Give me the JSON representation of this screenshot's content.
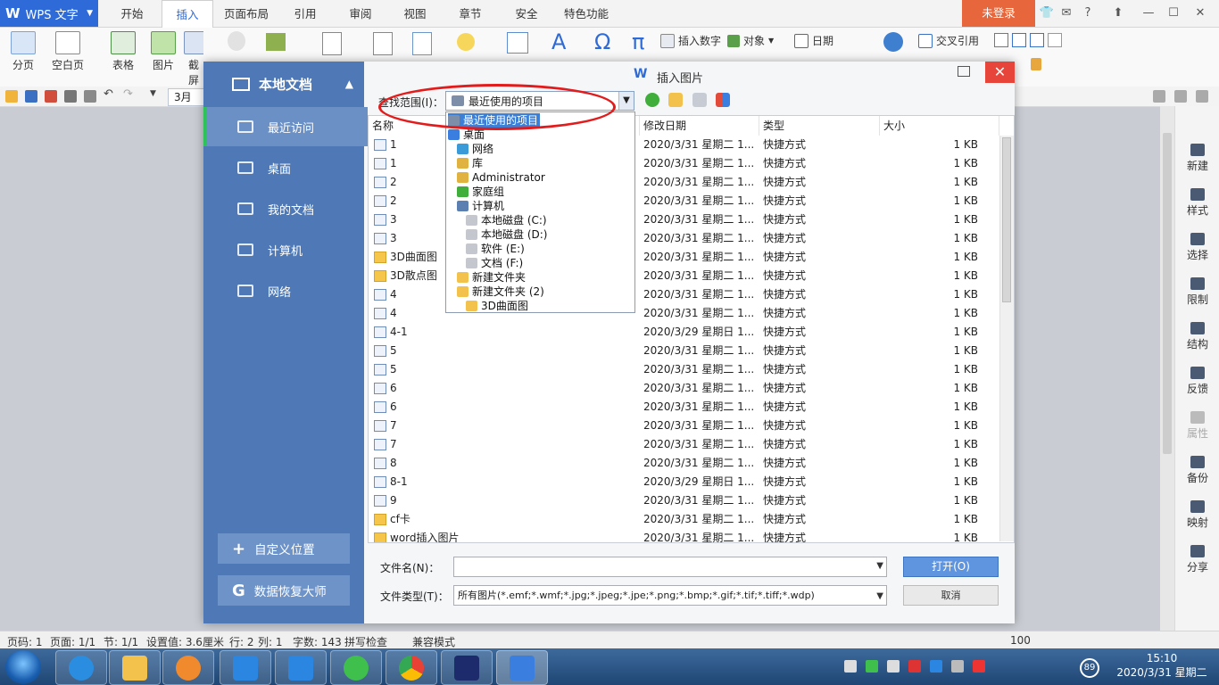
{
  "app": {
    "logo": "W",
    "name": "WPS 文字"
  },
  "tabs": [
    "开始",
    "插入",
    "页面布局",
    "引用",
    "审阅",
    "视图",
    "章节",
    "安全",
    "特色功能"
  ],
  "active_tab": "插入",
  "login_label": "未登录",
  "ribbon": {
    "big": [
      "分页",
      "空白页",
      "表格",
      "图片",
      "截屏"
    ],
    "small": [
      "插入数字",
      "对象",
      "日期",
      "交叉引用"
    ]
  },
  "doc_tab_label": "3月",
  "dialog": {
    "title": "插入图片",
    "left_header": "本地文档",
    "left_items": [
      "最近访问",
      "桌面",
      "我的文档",
      "计算机",
      "网络"
    ],
    "custom_location": "自定义位置",
    "recovery": "数据恢复大师",
    "lookin_label": "查找范围(I)：",
    "lookin_value": "最近使用的项目",
    "columns": {
      "name": "名称",
      "date": "修改日期",
      "type": "类型",
      "size": "大小"
    },
    "files": [
      {
        "name": "1",
        "date": "2020/3/31 星期二 1...",
        "type": "快捷方式",
        "size": "1 KB"
      },
      {
        "name": "1",
        "date": "2020/3/31 星期二 1...",
        "type": "快捷方式",
        "size": "1 KB"
      },
      {
        "name": "2",
        "date": "2020/3/31 星期二 1...",
        "type": "快捷方式",
        "size": "1 KB"
      },
      {
        "name": "2",
        "date": "2020/3/31 星期二 1...",
        "type": "快捷方式",
        "size": "1 KB"
      },
      {
        "name": "3",
        "date": "2020/3/31 星期二 1...",
        "type": "快捷方式",
        "size": "1 KB"
      },
      {
        "name": "3",
        "date": "2020/3/31 星期二 1...",
        "type": "快捷方式",
        "size": "1 KB"
      },
      {
        "name": "3D曲面图",
        "date": "2020/3/31 星期二 1...",
        "type": "快捷方式",
        "size": "1 KB"
      },
      {
        "name": "3D散点图",
        "date": "2020/3/31 星期二 1...",
        "type": "快捷方式",
        "size": "1 KB"
      },
      {
        "name": "4",
        "date": "2020/3/31 星期二 1...",
        "type": "快捷方式",
        "size": "1 KB"
      },
      {
        "name": "4",
        "date": "2020/3/31 星期二 1...",
        "type": "快捷方式",
        "size": "1 KB"
      },
      {
        "name": "4-1",
        "date": "2020/3/29 星期日 1...",
        "type": "快捷方式",
        "size": "1 KB"
      },
      {
        "name": "5",
        "date": "2020/3/31 星期二 1...",
        "type": "快捷方式",
        "size": "1 KB"
      },
      {
        "name": "5",
        "date": "2020/3/31 星期二 1...",
        "type": "快捷方式",
        "size": "1 KB"
      },
      {
        "name": "6",
        "date": "2020/3/31 星期二 1...",
        "type": "快捷方式",
        "size": "1 KB"
      },
      {
        "name": "6",
        "date": "2020/3/31 星期二 1...",
        "type": "快捷方式",
        "size": "1 KB"
      },
      {
        "name": "7",
        "date": "2020/3/31 星期二 1...",
        "type": "快捷方式",
        "size": "1 KB"
      },
      {
        "name": "7",
        "date": "2020/3/31 星期二 1...",
        "type": "快捷方式",
        "size": "1 KB"
      },
      {
        "name": "8",
        "date": "2020/3/31 星期二 1...",
        "type": "快捷方式",
        "size": "1 KB"
      },
      {
        "name": "8-1",
        "date": "2020/3/29 星期日 1...",
        "type": "快捷方式",
        "size": "1 KB"
      },
      {
        "name": "9",
        "date": "2020/3/31 星期二 1...",
        "type": "快捷方式",
        "size": "1 KB"
      },
      {
        "name": "cf卡",
        "date": "2020/3/31 星期二 1...",
        "type": "快捷方式",
        "size": "1 KB"
      },
      {
        "name": "word插入图片",
        "date": "2020/3/31 星期二 1...",
        "type": "快捷方式",
        "size": "1 KB"
      }
    ],
    "dropdown_items": [
      {
        "label": "最近使用的项目",
        "indent": 0,
        "selected": true,
        "icon": "recent-icon"
      },
      {
        "label": "桌面",
        "indent": 0,
        "selected": false,
        "icon": "desktop-icon"
      },
      {
        "label": "网络",
        "indent": 1,
        "selected": false,
        "icon": "network-icon"
      },
      {
        "label": "库",
        "indent": 1,
        "selected": false,
        "icon": "library-icon"
      },
      {
        "label": "Administrator",
        "indent": 1,
        "selected": false,
        "icon": "user-folder-icon"
      },
      {
        "label": "家庭组",
        "indent": 1,
        "selected": false,
        "icon": "homegroup-icon"
      },
      {
        "label": "计算机",
        "indent": 1,
        "selected": false,
        "icon": "computer-icon"
      },
      {
        "label": "本地磁盘 (C:)",
        "indent": 2,
        "selected": false,
        "icon": "drive-icon"
      },
      {
        "label": "本地磁盘 (D:)",
        "indent": 2,
        "selected": false,
        "icon": "drive-icon"
      },
      {
        "label": "软件 (E:)",
        "indent": 2,
        "selected": false,
        "icon": "drive-icon"
      },
      {
        "label": "文档 (F:)",
        "indent": 2,
        "selected": false,
        "icon": "drive-icon"
      },
      {
        "label": "新建文件夹",
        "indent": 1,
        "selected": false,
        "icon": "folder-icon"
      },
      {
        "label": "新建文件夹 (2)",
        "indent": 1,
        "selected": false,
        "icon": "folder-icon"
      },
      {
        "label": "3D曲面图",
        "indent": 2,
        "selected": false,
        "icon": "folder-icon"
      }
    ],
    "filename_label": "文件名(N)：",
    "filename_value": "",
    "filetype_label": "文件类型(T)：",
    "filetype_value": "所有图片(*.emf;*.wmf;*.jpg;*.jpeg;*.jpe;*.png;*.bmp;*.gif;*.tif;*.tiff;*.wdp)",
    "open_label": "打开(O)",
    "cancel_label": "取消"
  },
  "right_panel": [
    "新建",
    "样式",
    "选择",
    "限制",
    "结构",
    "反馈",
    "属性",
    "备份",
    "映射",
    "分享"
  ],
  "status": {
    "page_code": "页码: 1",
    "pages": "页面: 1/1",
    "section": "节: 1/1",
    "setting": "设置值: 3.6厘米",
    "line": "行: 2",
    "col": "列: 1",
    "words": "字数: 143",
    "spell": "拼写检查",
    "compat": "兼容模式",
    "zoom": "100"
  },
  "clock": {
    "time": "15:10",
    "date": "2020/3/31 星期二"
  },
  "tray_badge": "89",
  "colors": {
    "accent": "#2f6bd8",
    "login": "#e8663c",
    "dialog_left": "#4e79b6",
    "annotation": "#e21c1c"
  }
}
